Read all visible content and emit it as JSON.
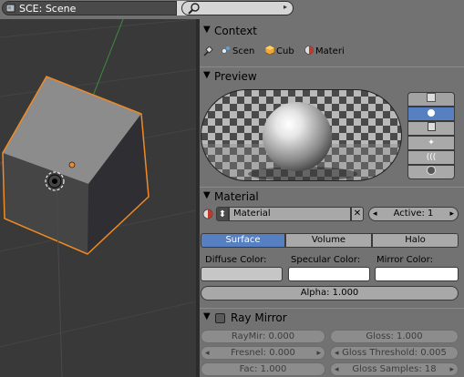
{
  "header": {
    "scene_name": "SCE: Scene",
    "close_glyph": "✕",
    "search_placeholder": ""
  },
  "context": {
    "title": "Context",
    "items": [
      {
        "label": "Scen",
        "icon": "scene-icon"
      },
      {
        "label": "Cub",
        "icon": "cube-icon"
      },
      {
        "label": "Materi",
        "icon": "material-icon"
      }
    ]
  },
  "preview": {
    "title": "Preview",
    "shape_buttons": [
      "flat-plane-icon",
      "sphere-icon",
      "cube-icon",
      "monkey-icon",
      "hair-icon",
      "sky-sphere-icon"
    ],
    "active_shape": 1
  },
  "material": {
    "title": "Material",
    "name": "Material",
    "active_label": "Active: 1",
    "tabs": [
      "Surface",
      "Volume",
      "Halo"
    ],
    "active_tab": 0,
    "diffuse_label": "Diffuse Color:",
    "specular_label": "Specular Color:",
    "mirror_label": "Mirror Color:",
    "diffuse_color": "#c6c6c6",
    "specular_color": "#ffffff",
    "mirror_color": "#ffffff",
    "alpha": "Alpha: 1.000"
  },
  "ray_mirror": {
    "title": "Ray Mirror",
    "raymir": "RayMir: 0.000",
    "gloss": "Gloss: 1.000",
    "fresnel": "Fresnel: 0.000",
    "gloss_threshold": "Gloss Threshold: 0.005",
    "fac": "Fac: 1.000",
    "gloss_samples": "Gloss Samples: 18"
  },
  "colors": {
    "accent": "#5680c2",
    "viewport_bg": "#393939",
    "selection_outline": "#f08a24"
  }
}
